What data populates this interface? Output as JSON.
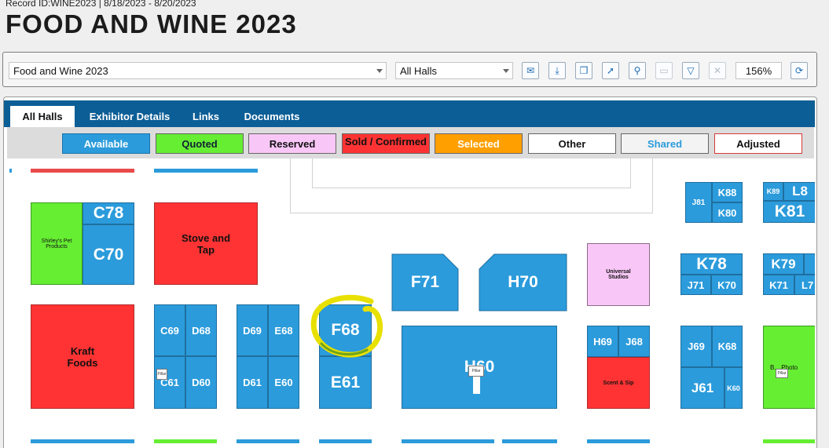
{
  "header": {
    "record_line": "Record ID:WINE2023 | 8/18/2023 - 8/20/2023",
    "title": "FOOD AND WINE 2023"
  },
  "toolbar": {
    "event_select": "Food and Wine 2023",
    "hall_select": "All Halls",
    "zoom": "156%",
    "icons": [
      "mail-icon",
      "download-icon",
      "copy-icon",
      "move-icon",
      "split-icon",
      "merge-icon",
      "filter-icon",
      "clear-icon",
      "refresh-icon"
    ]
  },
  "tabs": [
    {
      "label": "All Halls",
      "active": true
    },
    {
      "label": "Exhibitor Details",
      "active": false
    },
    {
      "label": "Links",
      "active": false
    },
    {
      "label": "Documents",
      "active": false
    }
  ],
  "legend": [
    {
      "label": "Available",
      "color": "#2b9bdb"
    },
    {
      "label": "Quoted",
      "color": "#66ee33"
    },
    {
      "label": "Reserved",
      "color": "#f9c7f7"
    },
    {
      "label": "Sold / Confirmed",
      "color": "#ff3333"
    },
    {
      "label": "Selected",
      "color": "#ff9f00"
    },
    {
      "label": "Other",
      "color": "#ffffff"
    },
    {
      "label": "Shared",
      "color": "#f3f3f3"
    },
    {
      "label": "Adjusted",
      "color": "#ffffff"
    }
  ],
  "booths": {
    "c78": "C78",
    "c70": "C70",
    "shirleys": "Shirley's Pet Products",
    "stove": "Stove and Tap",
    "kraft": "Kraft Foods",
    "c69": "C69",
    "d68": "D68",
    "c61": "C61",
    "d60": "D60",
    "d69": "D69",
    "e68": "E68",
    "d61": "D61",
    "e60": "E60",
    "f68": "F68",
    "e61": "E61",
    "f71": "F71",
    "h70": "H70",
    "h60": "H60",
    "universal": "Universal Studios",
    "h69": "H69",
    "j68": "J68",
    "scent": "Scent & Sip",
    "j81": "J81",
    "k88": "K88",
    "k80": "K80",
    "k89": "K89",
    "l8": "L8",
    "k81": "K81",
    "k78": "K78",
    "j71": "J71",
    "k70": "K70",
    "k79": "K79",
    "k71": "K71",
    "l7": "L7",
    "j69": "J69",
    "k68": "K68",
    "j61": "J61",
    "k60": "K60",
    "photo": "B... Photo",
    "pillar": "Pillar"
  }
}
